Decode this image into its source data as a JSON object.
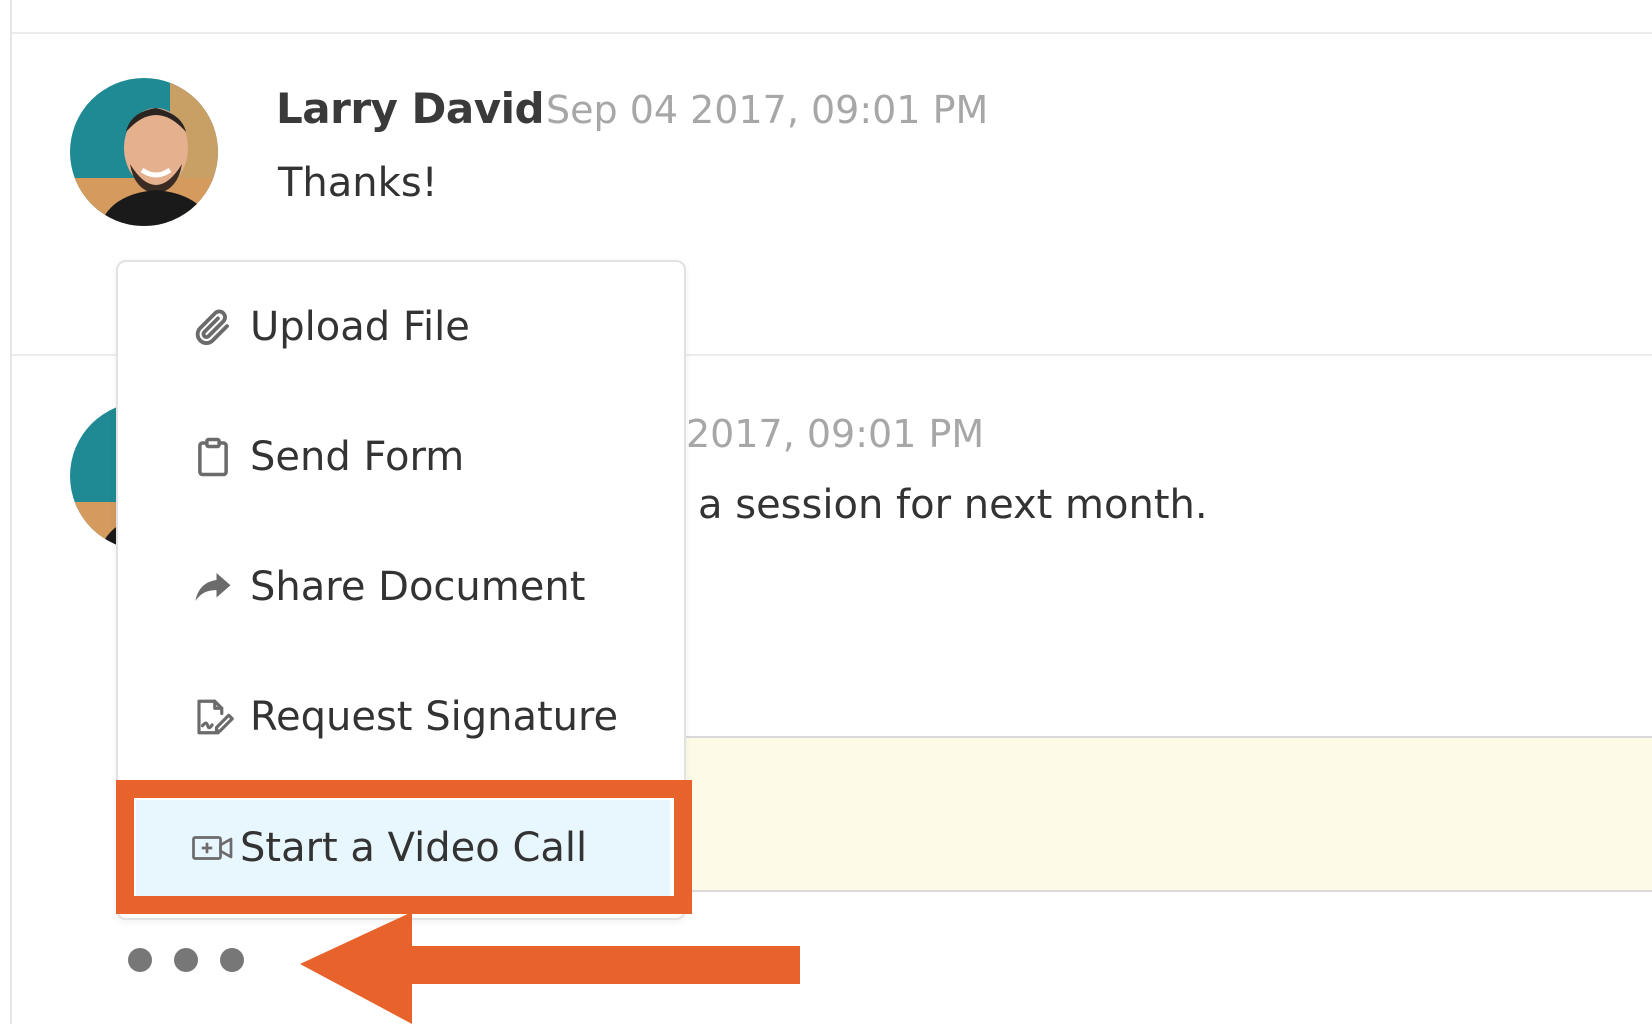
{
  "messages": [
    {
      "author": "Larry David",
      "timestamp": "Sep 04 2017, 09:01 PM",
      "text": "Thanks!"
    },
    {
      "author": "",
      "timestamp": "2017, 09:01 PM",
      "text": "a session for next month."
    }
  ],
  "menu": {
    "items": [
      {
        "label": "Upload File",
        "icon": "paperclip-icon"
      },
      {
        "label": "Send Form",
        "icon": "clipboard-icon"
      },
      {
        "label": "Share Document",
        "icon": "share-arrow-icon"
      },
      {
        "label": "Request Signature",
        "icon": "signature-icon"
      },
      {
        "label": "Start a Video Call",
        "icon": "video-call-icon"
      }
    ]
  },
  "colors": {
    "highlight": "#e8622c",
    "active_item_bg": "#e8f6fd",
    "composer_bg": "#fdfbe8"
  }
}
